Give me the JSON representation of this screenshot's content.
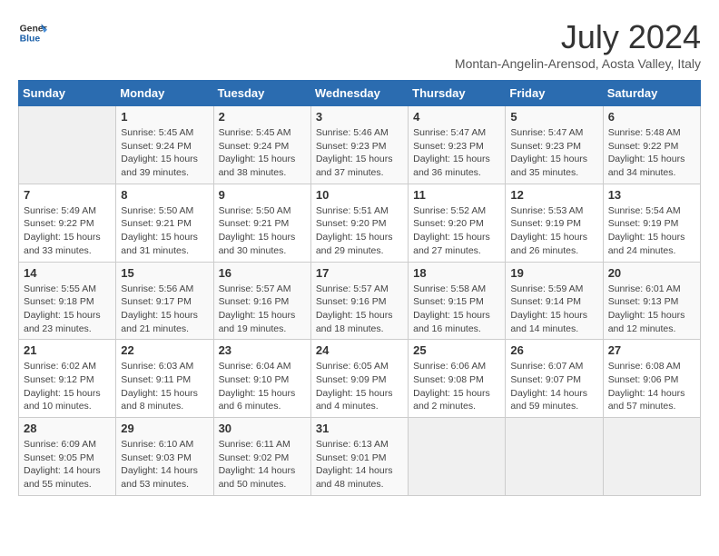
{
  "logo": {
    "line1": "General",
    "line2": "Blue"
  },
  "title": {
    "month_year": "July 2024",
    "location": "Montan-Angelin-Arensod, Aosta Valley, Italy"
  },
  "headers": [
    "Sunday",
    "Monday",
    "Tuesday",
    "Wednesday",
    "Thursday",
    "Friday",
    "Saturday"
  ],
  "weeks": [
    [
      {
        "day": "",
        "sunrise": "",
        "sunset": "",
        "daylight": ""
      },
      {
        "day": "1",
        "sunrise": "Sunrise: 5:45 AM",
        "sunset": "Sunset: 9:24 PM",
        "daylight": "Daylight: 15 hours and 39 minutes."
      },
      {
        "day": "2",
        "sunrise": "Sunrise: 5:45 AM",
        "sunset": "Sunset: 9:24 PM",
        "daylight": "Daylight: 15 hours and 38 minutes."
      },
      {
        "day": "3",
        "sunrise": "Sunrise: 5:46 AM",
        "sunset": "Sunset: 9:23 PM",
        "daylight": "Daylight: 15 hours and 37 minutes."
      },
      {
        "day": "4",
        "sunrise": "Sunrise: 5:47 AM",
        "sunset": "Sunset: 9:23 PM",
        "daylight": "Daylight: 15 hours and 36 minutes."
      },
      {
        "day": "5",
        "sunrise": "Sunrise: 5:47 AM",
        "sunset": "Sunset: 9:23 PM",
        "daylight": "Daylight: 15 hours and 35 minutes."
      },
      {
        "day": "6",
        "sunrise": "Sunrise: 5:48 AM",
        "sunset": "Sunset: 9:22 PM",
        "daylight": "Daylight: 15 hours and 34 minutes."
      }
    ],
    [
      {
        "day": "7",
        "sunrise": "Sunrise: 5:49 AM",
        "sunset": "Sunset: 9:22 PM",
        "daylight": "Daylight: 15 hours and 33 minutes."
      },
      {
        "day": "8",
        "sunrise": "Sunrise: 5:50 AM",
        "sunset": "Sunset: 9:21 PM",
        "daylight": "Daylight: 15 hours and 31 minutes."
      },
      {
        "day": "9",
        "sunrise": "Sunrise: 5:50 AM",
        "sunset": "Sunset: 9:21 PM",
        "daylight": "Daylight: 15 hours and 30 minutes."
      },
      {
        "day": "10",
        "sunrise": "Sunrise: 5:51 AM",
        "sunset": "Sunset: 9:20 PM",
        "daylight": "Daylight: 15 hours and 29 minutes."
      },
      {
        "day": "11",
        "sunrise": "Sunrise: 5:52 AM",
        "sunset": "Sunset: 9:20 PM",
        "daylight": "Daylight: 15 hours and 27 minutes."
      },
      {
        "day": "12",
        "sunrise": "Sunrise: 5:53 AM",
        "sunset": "Sunset: 9:19 PM",
        "daylight": "Daylight: 15 hours and 26 minutes."
      },
      {
        "day": "13",
        "sunrise": "Sunrise: 5:54 AM",
        "sunset": "Sunset: 9:19 PM",
        "daylight": "Daylight: 15 hours and 24 minutes."
      }
    ],
    [
      {
        "day": "14",
        "sunrise": "Sunrise: 5:55 AM",
        "sunset": "Sunset: 9:18 PM",
        "daylight": "Daylight: 15 hours and 23 minutes."
      },
      {
        "day": "15",
        "sunrise": "Sunrise: 5:56 AM",
        "sunset": "Sunset: 9:17 PM",
        "daylight": "Daylight: 15 hours and 21 minutes."
      },
      {
        "day": "16",
        "sunrise": "Sunrise: 5:57 AM",
        "sunset": "Sunset: 9:16 PM",
        "daylight": "Daylight: 15 hours and 19 minutes."
      },
      {
        "day": "17",
        "sunrise": "Sunrise: 5:57 AM",
        "sunset": "Sunset: 9:16 PM",
        "daylight": "Daylight: 15 hours and 18 minutes."
      },
      {
        "day": "18",
        "sunrise": "Sunrise: 5:58 AM",
        "sunset": "Sunset: 9:15 PM",
        "daylight": "Daylight: 15 hours and 16 minutes."
      },
      {
        "day": "19",
        "sunrise": "Sunrise: 5:59 AM",
        "sunset": "Sunset: 9:14 PM",
        "daylight": "Daylight: 15 hours and 14 minutes."
      },
      {
        "day": "20",
        "sunrise": "Sunrise: 6:01 AM",
        "sunset": "Sunset: 9:13 PM",
        "daylight": "Daylight: 15 hours and 12 minutes."
      }
    ],
    [
      {
        "day": "21",
        "sunrise": "Sunrise: 6:02 AM",
        "sunset": "Sunset: 9:12 PM",
        "daylight": "Daylight: 15 hours and 10 minutes."
      },
      {
        "day": "22",
        "sunrise": "Sunrise: 6:03 AM",
        "sunset": "Sunset: 9:11 PM",
        "daylight": "Daylight: 15 hours and 8 minutes."
      },
      {
        "day": "23",
        "sunrise": "Sunrise: 6:04 AM",
        "sunset": "Sunset: 9:10 PM",
        "daylight": "Daylight: 15 hours and 6 minutes."
      },
      {
        "day": "24",
        "sunrise": "Sunrise: 6:05 AM",
        "sunset": "Sunset: 9:09 PM",
        "daylight": "Daylight: 15 hours and 4 minutes."
      },
      {
        "day": "25",
        "sunrise": "Sunrise: 6:06 AM",
        "sunset": "Sunset: 9:08 PM",
        "daylight": "Daylight: 15 hours and 2 minutes."
      },
      {
        "day": "26",
        "sunrise": "Sunrise: 6:07 AM",
        "sunset": "Sunset: 9:07 PM",
        "daylight": "Daylight: 14 hours and 59 minutes."
      },
      {
        "day": "27",
        "sunrise": "Sunrise: 6:08 AM",
        "sunset": "Sunset: 9:06 PM",
        "daylight": "Daylight: 14 hours and 57 minutes."
      }
    ],
    [
      {
        "day": "28",
        "sunrise": "Sunrise: 6:09 AM",
        "sunset": "Sunset: 9:05 PM",
        "daylight": "Daylight: 14 hours and 55 minutes."
      },
      {
        "day": "29",
        "sunrise": "Sunrise: 6:10 AM",
        "sunset": "Sunset: 9:03 PM",
        "daylight": "Daylight: 14 hours and 53 minutes."
      },
      {
        "day": "30",
        "sunrise": "Sunrise: 6:11 AM",
        "sunset": "Sunset: 9:02 PM",
        "daylight": "Daylight: 14 hours and 50 minutes."
      },
      {
        "day": "31",
        "sunrise": "Sunrise: 6:13 AM",
        "sunset": "Sunset: 9:01 PM",
        "daylight": "Daylight: 14 hours and 48 minutes."
      },
      {
        "day": "",
        "sunrise": "",
        "sunset": "",
        "daylight": ""
      },
      {
        "day": "",
        "sunrise": "",
        "sunset": "",
        "daylight": ""
      },
      {
        "day": "",
        "sunrise": "",
        "sunset": "",
        "daylight": ""
      }
    ]
  ]
}
